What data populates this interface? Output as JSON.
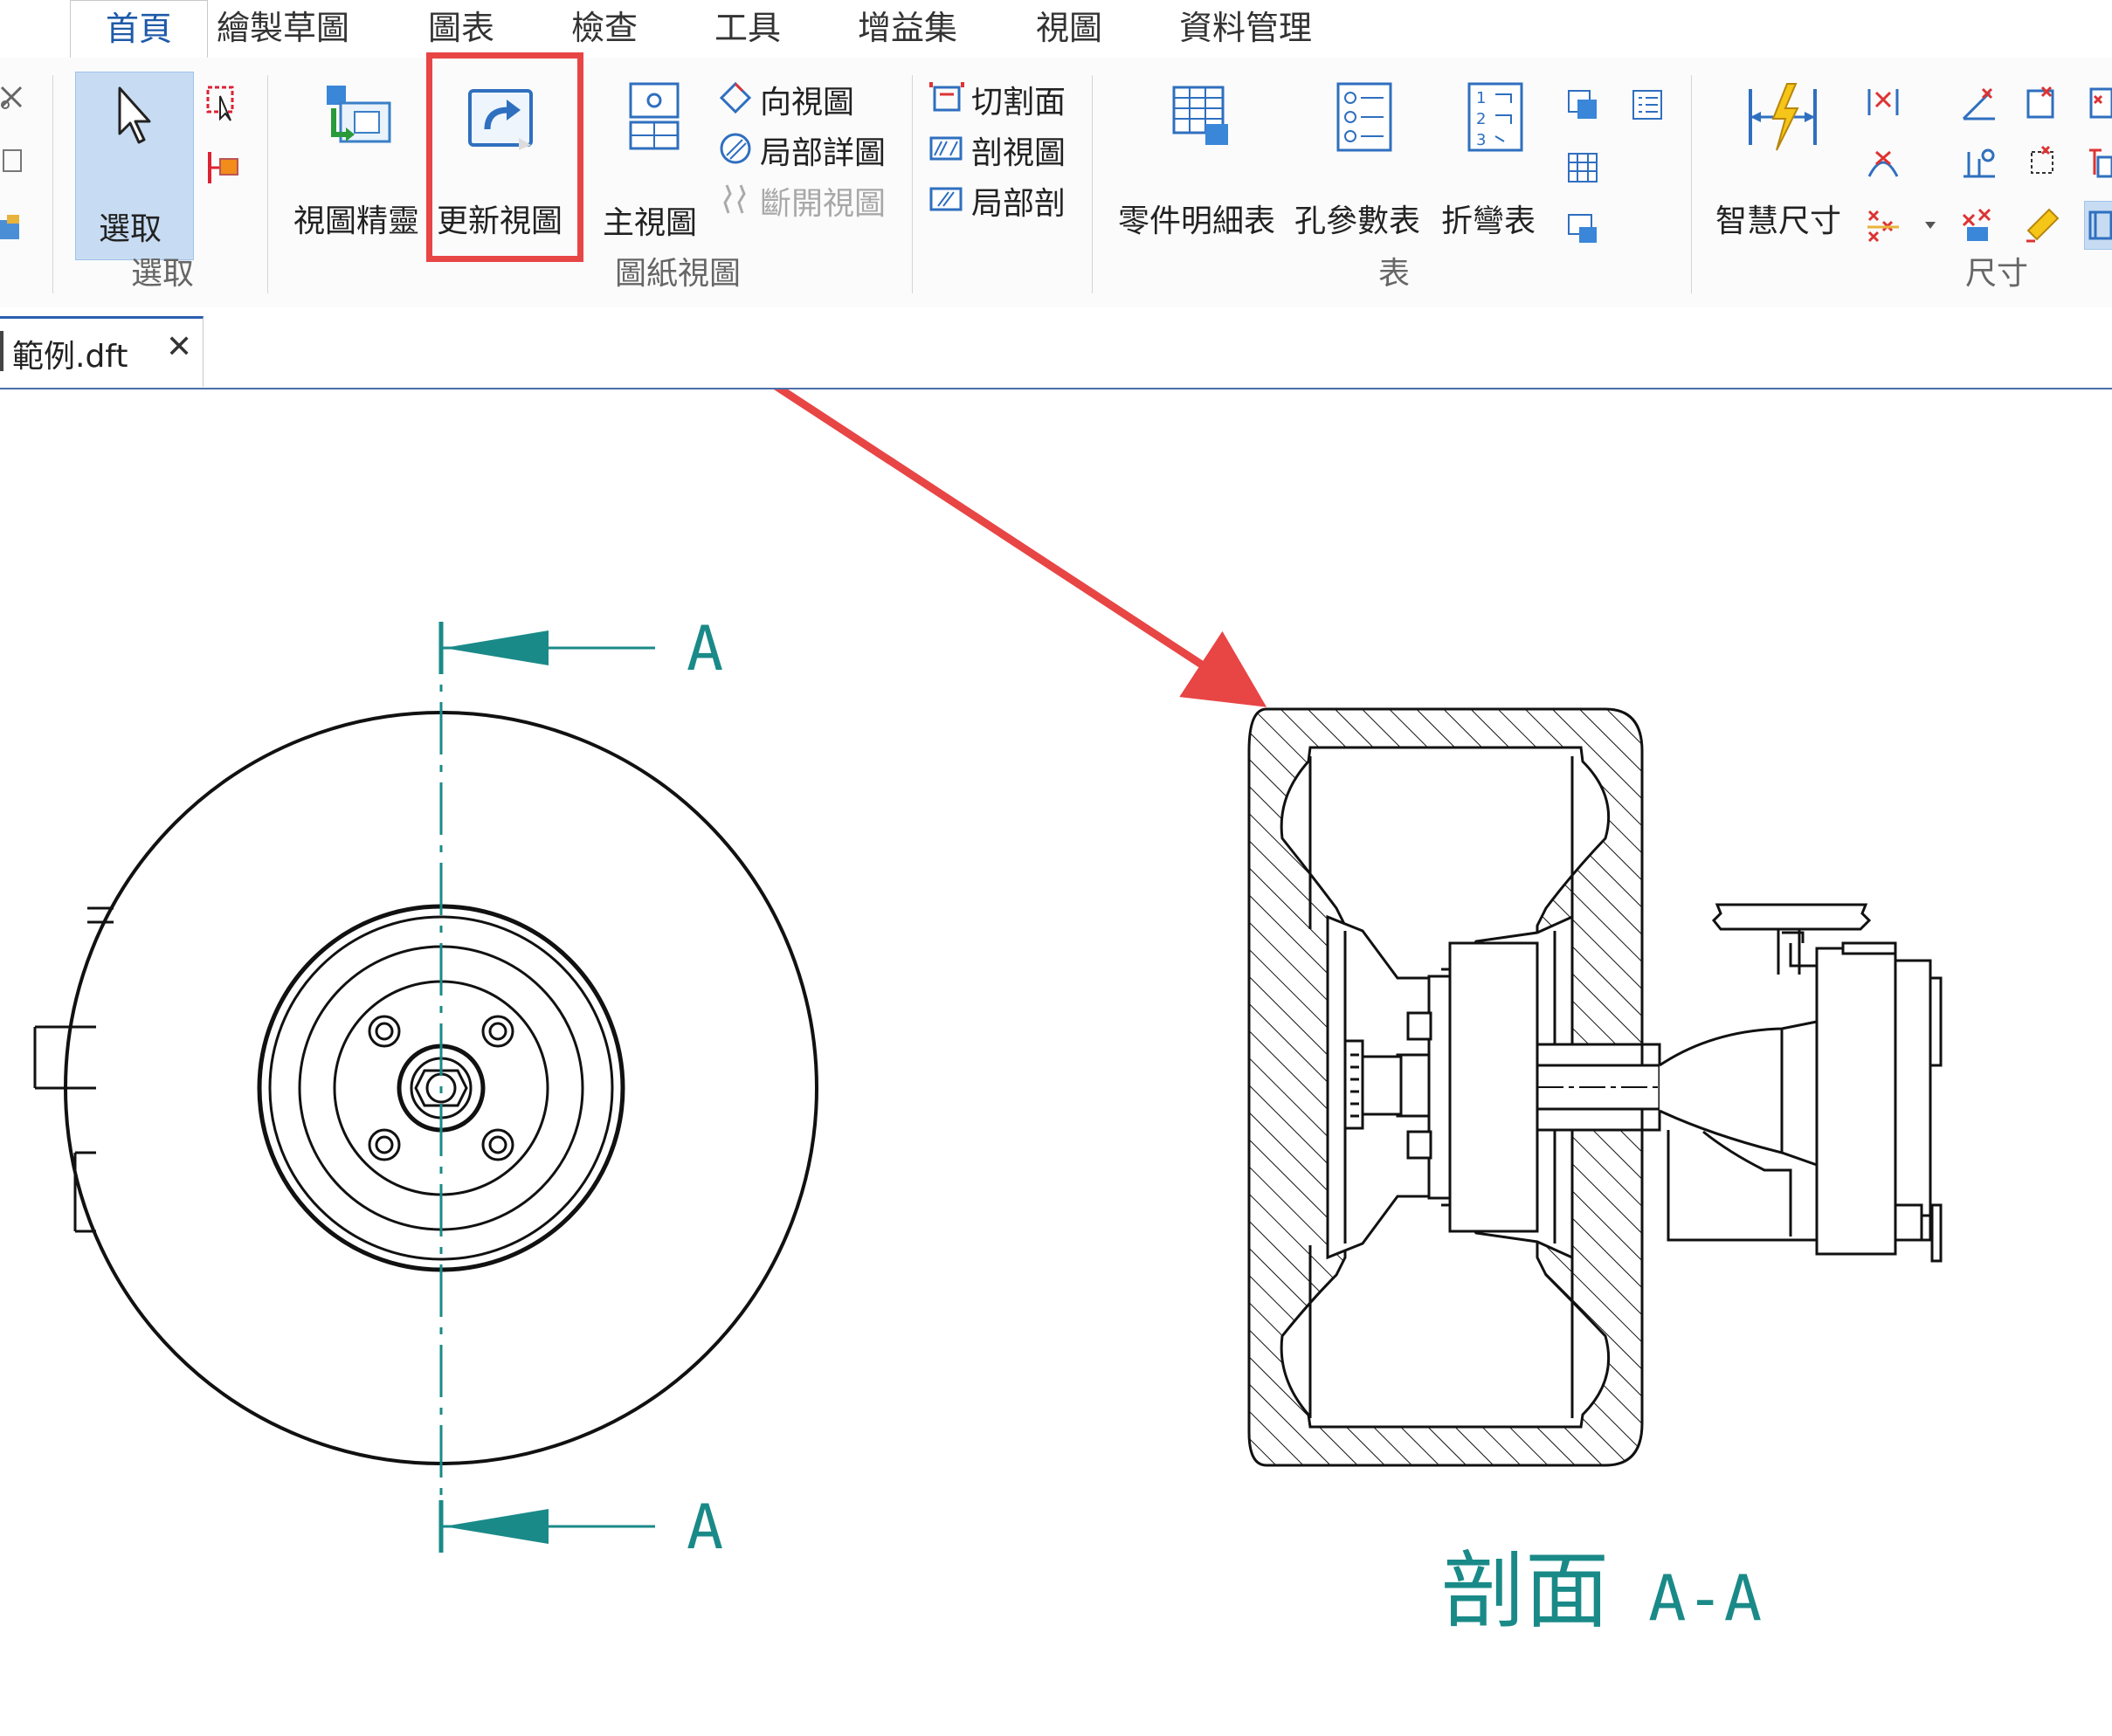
{
  "menu_tabs": [
    "首頁",
    "繪製草圖",
    "圖表",
    "檢查",
    "工具",
    "增益集",
    "視圖",
    "資料管理"
  ],
  "ribbon": {
    "select_group": {
      "select_label": "選取",
      "group_label": "選取"
    },
    "drawing_views": {
      "view_wizard": "視圖精靈",
      "update_views": "更新視圖",
      "principal_view": "主視圖",
      "auxiliary_view": "向視圖",
      "detail_view": "局部詳圖",
      "broken_view": "斷開視圖",
      "cutting_plane": "切割面",
      "section_view": "剖視圖",
      "broken_out_section": "局部剖",
      "group_label": "圖紙視圖"
    },
    "tables": {
      "parts_list": "零件明細表",
      "hole_table": "孔參數表",
      "bend_table": "折彎表",
      "group_label": "表"
    },
    "dimension": {
      "smart_dimension": "智慧尺寸",
      "group_label": "尺寸"
    }
  },
  "document_tab": {
    "name": "範例.dft",
    "close": "✕"
  },
  "drawing": {
    "section_letter_top": "A",
    "section_letter_bottom": "A",
    "section_caption_prefix": "剖面",
    "section_caption_id": "A-A"
  },
  "colors": {
    "highlight": "#e84545",
    "annotation": "#1a8a88",
    "active_tab": "#1e5aa8",
    "select_bg": "#c7dcf3"
  }
}
